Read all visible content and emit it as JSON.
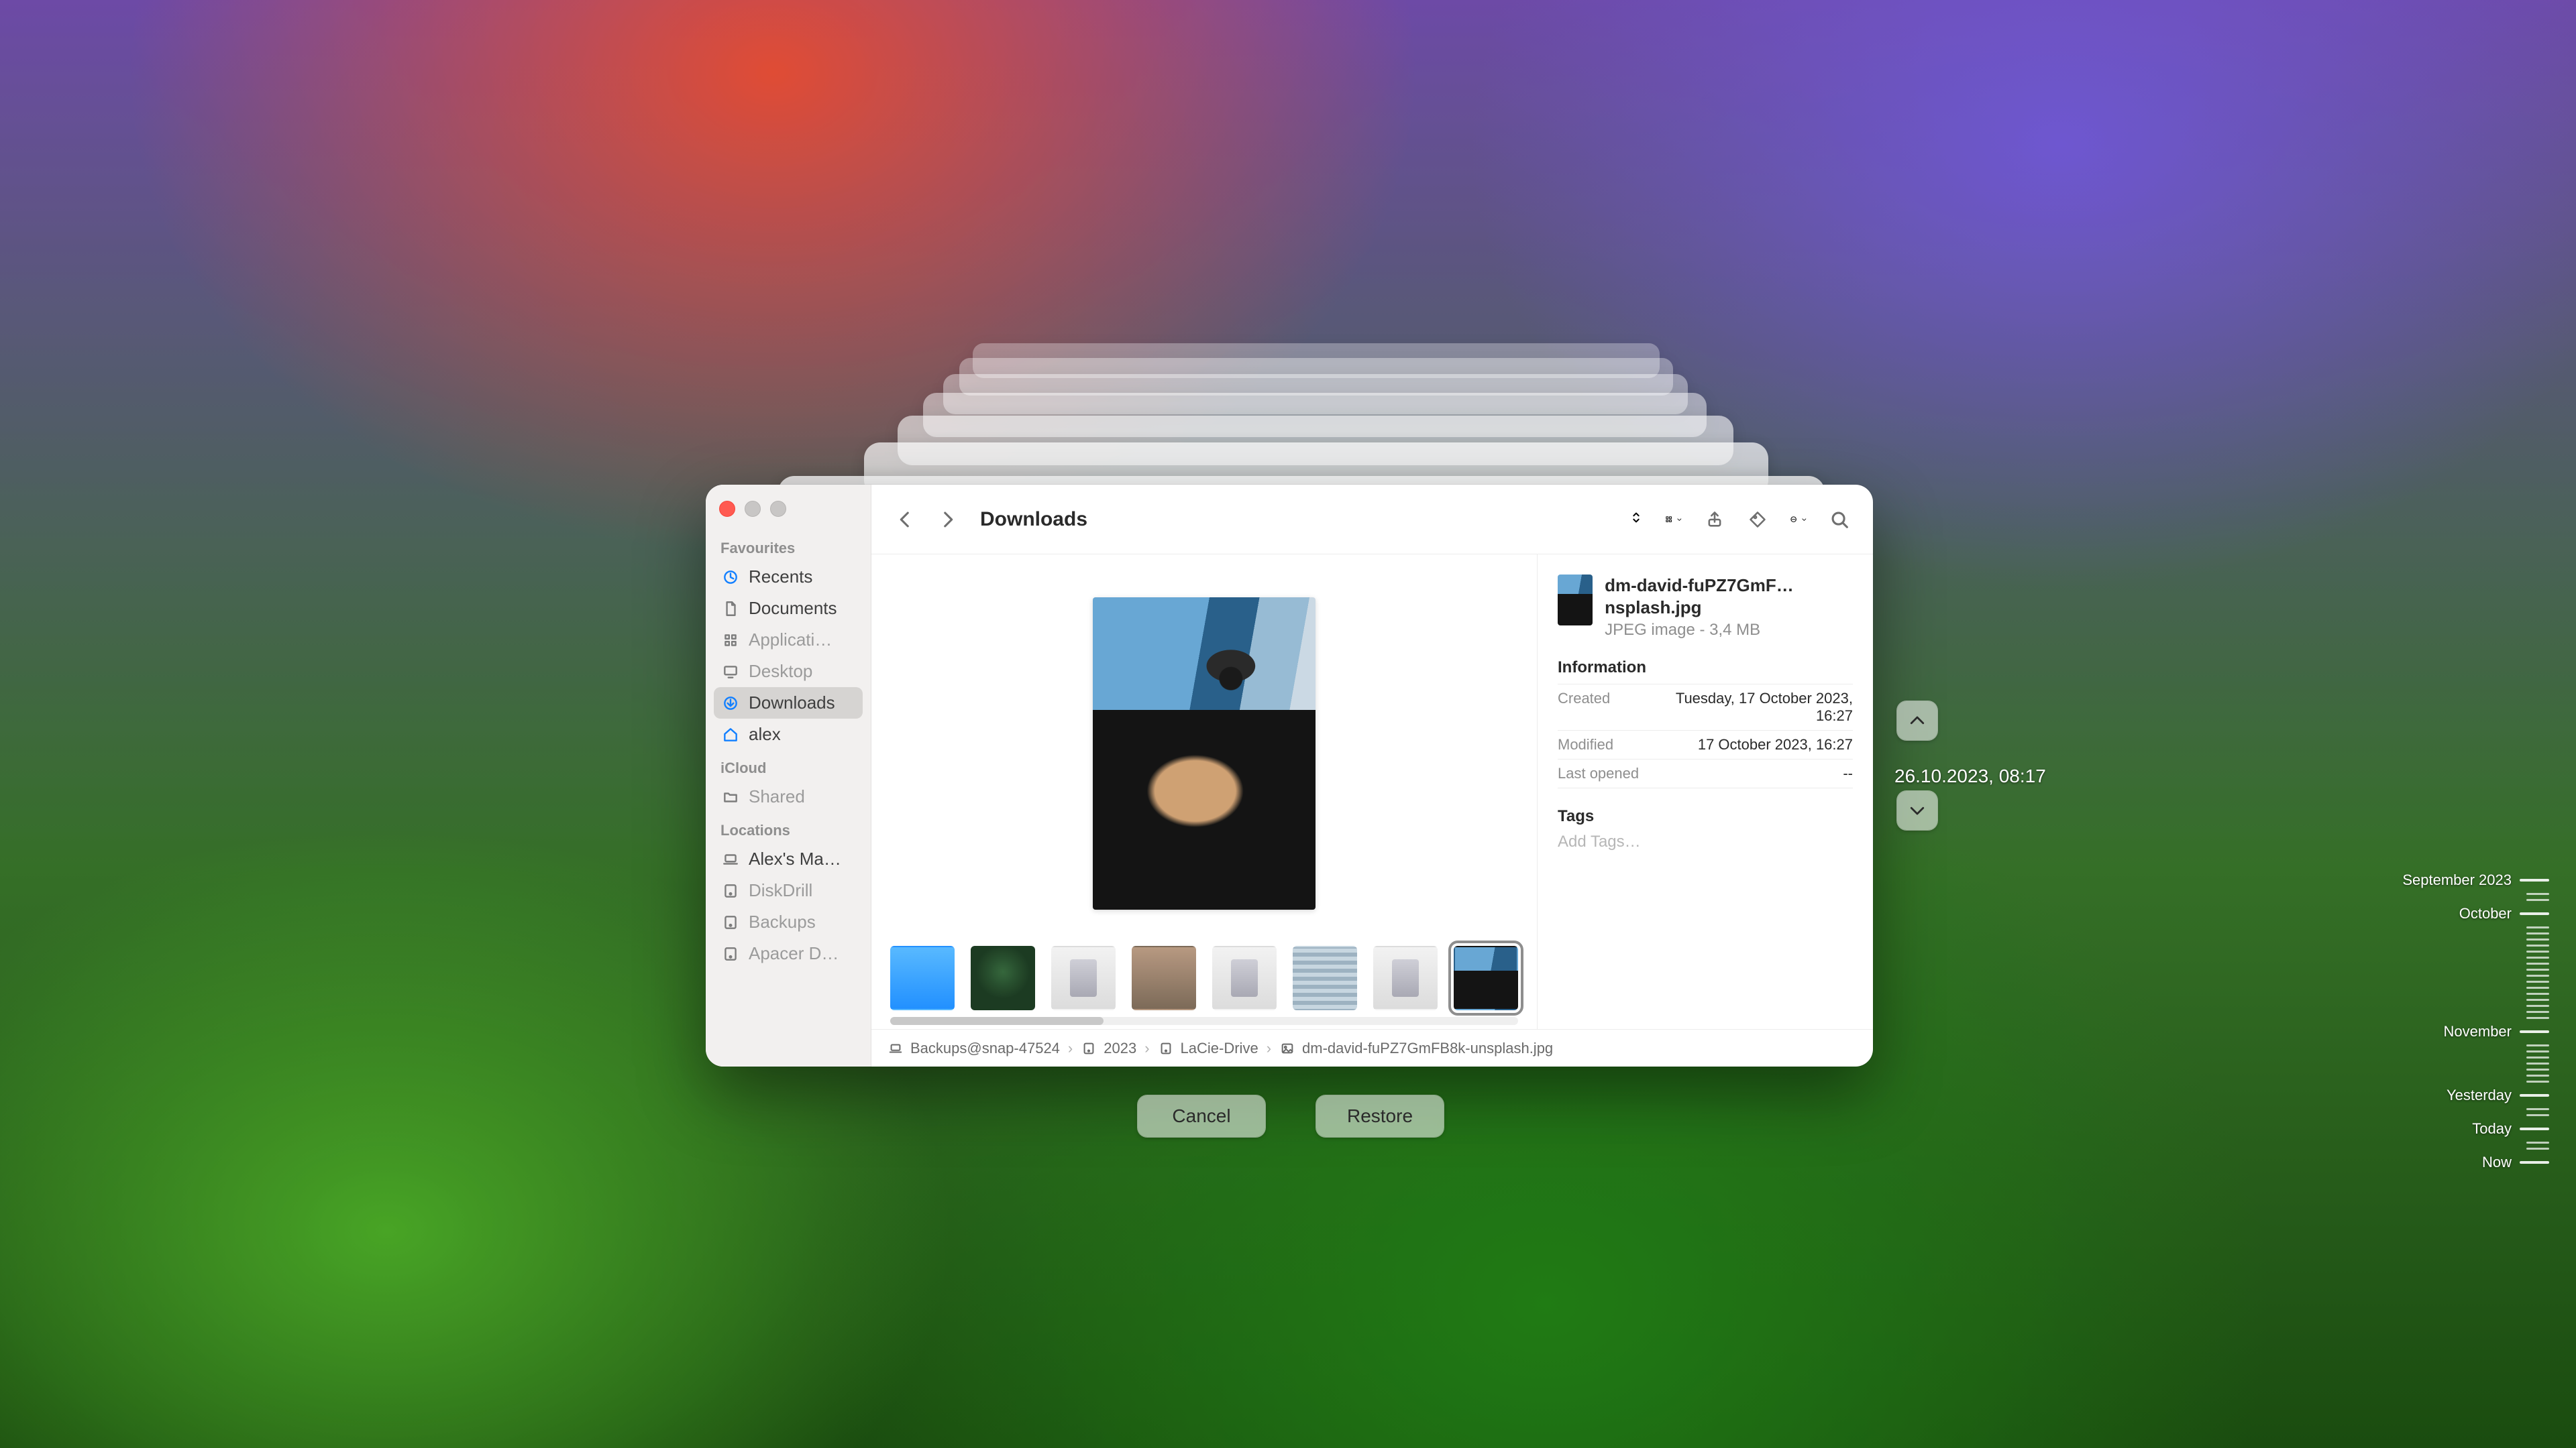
{
  "window_title": "Downloads",
  "sidebar": {
    "sections": [
      {
        "title": "Favourites",
        "items": [
          {
            "label": "Recents",
            "icon": "clock-icon",
            "accent": true,
            "dim": false
          },
          {
            "label": "Documents",
            "icon": "document-icon",
            "accent": false,
            "dim": false
          },
          {
            "label": "Applicati…",
            "icon": "apps-icon",
            "accent": false,
            "dim": true
          },
          {
            "label": "Desktop",
            "icon": "desktop-icon",
            "accent": false,
            "dim": true
          },
          {
            "label": "Downloads",
            "icon": "download-icon",
            "accent": true,
            "dim": false,
            "selected": true
          },
          {
            "label": "alex",
            "icon": "home-icon",
            "accent": true,
            "dim": false
          }
        ]
      },
      {
        "title": "iCloud",
        "items": [
          {
            "label": "Shared",
            "icon": "folder-icon",
            "accent": false,
            "dim": true
          }
        ]
      },
      {
        "title": "Locations",
        "items": [
          {
            "label": "Alex's Ma…",
            "icon": "laptop-icon",
            "accent": false,
            "dim": false
          },
          {
            "label": "DiskDrill",
            "icon": "disk-icon",
            "accent": false,
            "dim": true
          },
          {
            "label": "Backups",
            "icon": "disk-icon",
            "accent": false,
            "dim": true
          },
          {
            "label": "Apacer D…",
            "icon": "disk-icon",
            "accent": false,
            "dim": true
          }
        ]
      }
    ]
  },
  "info": {
    "filename": "dm-david-fuPZ7GmF…nsplash.jpg",
    "subtitle": "JPEG image - 3,4 MB",
    "section_title": "Information",
    "rows": [
      {
        "key": "Created",
        "value": "Tuesday, 17 October 2023, 16:27"
      },
      {
        "key": "Modified",
        "value": "17 October 2023, 16:27"
      },
      {
        "key": "Last opened",
        "value": "--"
      }
    ],
    "tags_title": "Tags",
    "tags_placeholder": "Add Tags…"
  },
  "pathbar": [
    {
      "icon": "laptop-icon",
      "label": "Backups@snap-47524"
    },
    {
      "icon": "disk-icon",
      "label": "2023"
    },
    {
      "icon": "disk-icon",
      "label": "LaCie-Drive"
    },
    {
      "icon": "image-icon",
      "label": "dm-david-fuPZ7GmFB8k-unsplash.jpg"
    }
  ],
  "buttons": {
    "cancel": "Cancel",
    "restore": "Restore"
  },
  "snapshot_label": "26.10.2023, 08:17",
  "timeline": [
    {
      "label": "September 2023"
    },
    {
      "label": "October"
    },
    {
      "label": "November"
    },
    {
      "label": "Yesterday"
    },
    {
      "label": "Today"
    },
    {
      "label": "Now"
    }
  ]
}
